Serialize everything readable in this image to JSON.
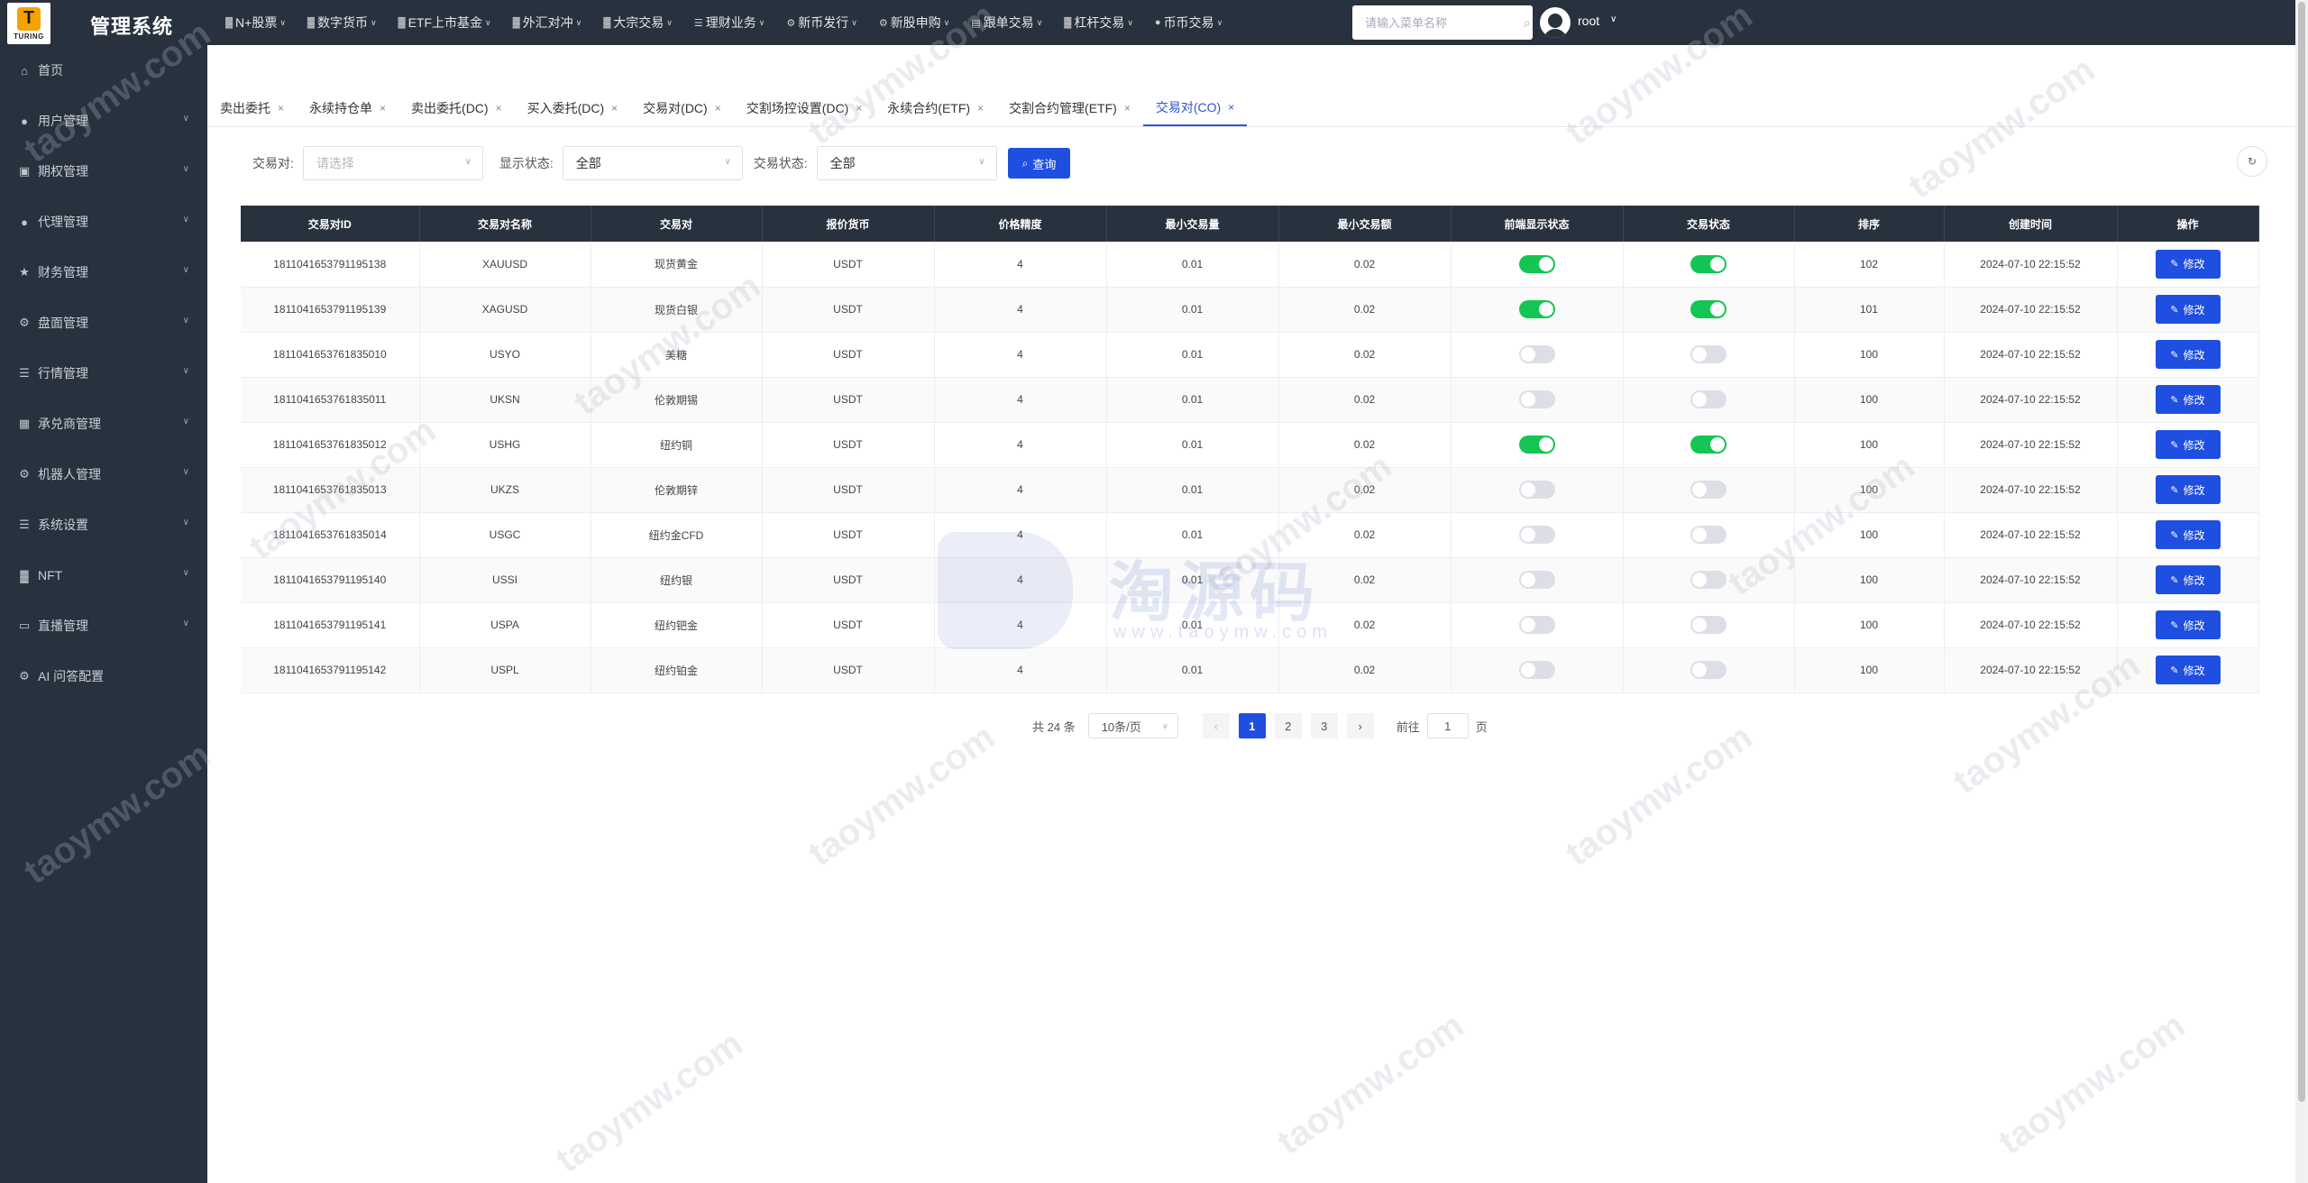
{
  "header": {
    "logo_text": "TURING",
    "logo_letter": "T",
    "title": "管理系统",
    "nav": [
      {
        "label": "N+股票",
        "icon": "bar-chart-icon"
      },
      {
        "label": "数字货币",
        "icon": "bar-chart-icon"
      },
      {
        "label": "ETF上市基金",
        "icon": "bar-chart-icon"
      },
      {
        "label": "外汇对冲",
        "icon": "bar-chart-icon"
      },
      {
        "label": "大宗交易",
        "icon": "bar-chart-icon"
      },
      {
        "label": "理财业务",
        "icon": "list-icon"
      },
      {
        "label": "新币发行",
        "icon": "gear-icon"
      },
      {
        "label": "新股申购",
        "icon": "gear-icon"
      },
      {
        "label": "跟单交易",
        "icon": "document-icon"
      },
      {
        "label": "杠杆交易",
        "icon": "bar-chart-icon"
      },
      {
        "label": "币币交易",
        "icon": "pin-icon"
      }
    ],
    "search_placeholder": "请输入菜单名称",
    "username": "root"
  },
  "sidebar": {
    "items": [
      {
        "label": "首页",
        "icon": "home-icon",
        "has_children": false
      },
      {
        "label": "用户管理",
        "icon": "user-icon",
        "has_children": true
      },
      {
        "label": "期权管理",
        "icon": "chart-icon",
        "has_children": true
      },
      {
        "label": "代理管理",
        "icon": "user-icon",
        "has_children": true
      },
      {
        "label": "财务管理",
        "icon": "star-icon",
        "has_children": true
      },
      {
        "label": "盘面管理",
        "icon": "gear-icon",
        "has_children": true
      },
      {
        "label": "行情管理",
        "icon": "list-icon",
        "has_children": true
      },
      {
        "label": "承兑商管理",
        "icon": "table-icon",
        "has_children": true
      },
      {
        "label": "机器人管理",
        "icon": "gear-icon",
        "has_children": true
      },
      {
        "label": "系统设置",
        "icon": "list-icon",
        "has_children": true
      },
      {
        "label": "NFT",
        "icon": "bar-chart-icon",
        "has_children": true
      },
      {
        "label": "直播管理",
        "icon": "video-icon",
        "has_children": true
      },
      {
        "label": "AI 问答配置",
        "icon": "gear-icon",
        "has_children": false
      }
    ]
  },
  "tabs": [
    {
      "label": "卖出委托",
      "active": false
    },
    {
      "label": "永续持仓单",
      "active": false
    },
    {
      "label": "卖出委托(DC)",
      "active": false
    },
    {
      "label": "买入委托(DC)",
      "active": false
    },
    {
      "label": "交易对(DC)",
      "active": false
    },
    {
      "label": "交割场控设置(DC)",
      "active": false
    },
    {
      "label": "永续合约(ETF)",
      "active": false
    },
    {
      "label": "交割合约管理(ETF)",
      "active": false
    },
    {
      "label": "交易对(CO)",
      "active": true
    }
  ],
  "filters": {
    "pair_label": "交易对:",
    "pair_placeholder": "请选择",
    "display_label": "显示状态:",
    "display_value": "全部",
    "trade_label": "交易状态:",
    "trade_value": "全部",
    "query_label": "查询"
  },
  "table": {
    "columns": [
      "交易对ID",
      "交易对名称",
      "交易对",
      "报价货币",
      "价格精度",
      "最小交易量",
      "最小交易额",
      "前端显示状态",
      "交易状态",
      "排序",
      "创建时间",
      "操作"
    ],
    "edit_label": "修改",
    "rows": [
      {
        "id": "1811041653791195138",
        "name": "XAUUSD",
        "pair": "现货黄金",
        "quote": "USDT",
        "precision": "4",
        "min_qty": "0.01",
        "min_amount": "0.02",
        "display": true,
        "trade": true,
        "sort": "102",
        "created": "2024-07-10 22:15:52"
      },
      {
        "id": "1811041653791195139",
        "name": "XAGUSD",
        "pair": "现货白银",
        "quote": "USDT",
        "precision": "4",
        "min_qty": "0.01",
        "min_amount": "0.02",
        "display": true,
        "trade": true,
        "sort": "101",
        "created": "2024-07-10 22:15:52"
      },
      {
        "id": "1811041653761835010",
        "name": "USYO",
        "pair": "美糖",
        "quote": "USDT",
        "precision": "4",
        "min_qty": "0.01",
        "min_amount": "0.02",
        "display": false,
        "trade": false,
        "sort": "100",
        "created": "2024-07-10 22:15:52"
      },
      {
        "id": "1811041653761835011",
        "name": "UKSN",
        "pair": "伦敦期锡",
        "quote": "USDT",
        "precision": "4",
        "min_qty": "0.01",
        "min_amount": "0.02",
        "display": false,
        "trade": false,
        "sort": "100",
        "created": "2024-07-10 22:15:52"
      },
      {
        "id": "1811041653761835012",
        "name": "USHG",
        "pair": "纽约铜",
        "quote": "USDT",
        "precision": "4",
        "min_qty": "0.01",
        "min_amount": "0.02",
        "display": true,
        "trade": true,
        "sort": "100",
        "created": "2024-07-10 22:15:52"
      },
      {
        "id": "1811041653761835013",
        "name": "UKZS",
        "pair": "伦敦期锌",
        "quote": "USDT",
        "precision": "4",
        "min_qty": "0.01",
        "min_amount": "0.02",
        "display": false,
        "trade": false,
        "sort": "100",
        "created": "2024-07-10 22:15:52"
      },
      {
        "id": "1811041653761835014",
        "name": "USGC",
        "pair": "纽约金CFD",
        "quote": "USDT",
        "precision": "4",
        "min_qty": "0.01",
        "min_amount": "0.02",
        "display": false,
        "trade": false,
        "sort": "100",
        "created": "2024-07-10 22:15:52"
      },
      {
        "id": "1811041653791195140",
        "name": "USSI",
        "pair": "纽约银",
        "quote": "USDT",
        "precision": "4",
        "min_qty": "0.01",
        "min_amount": "0.02",
        "display": false,
        "trade": false,
        "sort": "100",
        "created": "2024-07-10 22:15:52"
      },
      {
        "id": "1811041653791195141",
        "name": "USPA",
        "pair": "纽约钯金",
        "quote": "USDT",
        "precision": "4",
        "min_qty": "0.01",
        "min_amount": "0.02",
        "display": false,
        "trade": false,
        "sort": "100",
        "created": "2024-07-10 22:15:52"
      },
      {
        "id": "1811041653791195142",
        "name": "USPL",
        "pair": "纽约铂金",
        "quote": "USDT",
        "precision": "4",
        "min_qty": "0.01",
        "min_amount": "0.02",
        "display": false,
        "trade": false,
        "sort": "100",
        "created": "2024-07-10 22:15:52"
      }
    ]
  },
  "pagination": {
    "total_label": "共 24 条",
    "page_size": "10条/页",
    "pages": [
      "1",
      "2",
      "3"
    ],
    "current": "1",
    "goto_label": "前往",
    "goto_value": "1",
    "page_suffix": "页"
  },
  "watermark": {
    "text": "taoymw.com",
    "center_cn": "淘源码",
    "center_url": "www.taoymw.com"
  },
  "colors": {
    "sidebar_bg": "#28323e",
    "primary": "#1f4fe0",
    "switch_on": "#13c552",
    "switch_off": "#dcdfe6"
  }
}
